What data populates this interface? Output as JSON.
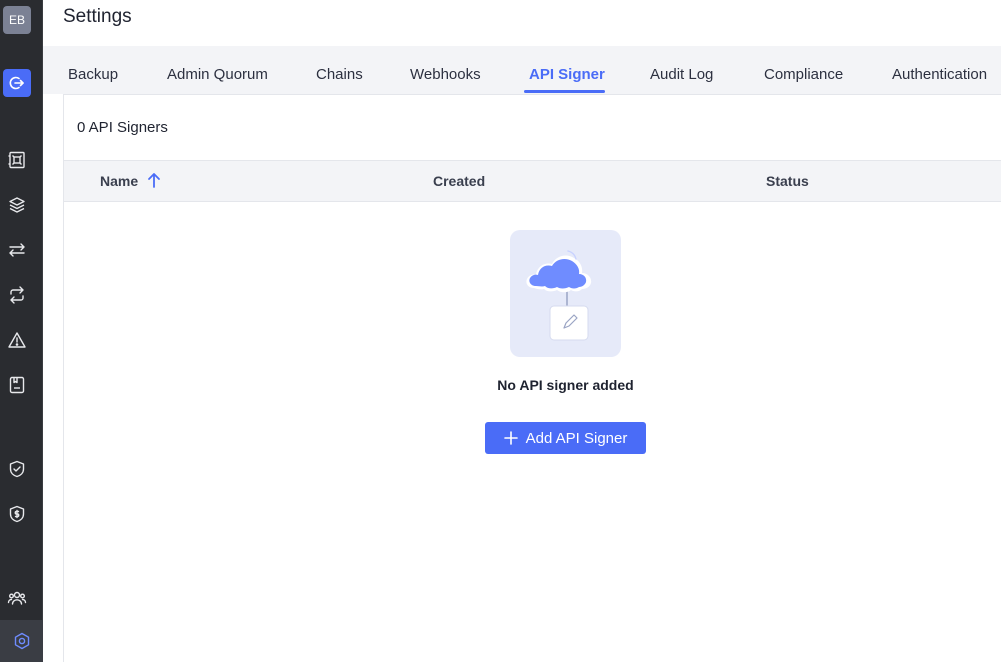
{
  "user": {
    "initials": "EB"
  },
  "sidebar": {
    "items": [
      {
        "icon": "logout-icon"
      },
      {
        "icon": "vault-icon"
      },
      {
        "icon": "layers-icon"
      },
      {
        "icon": "transfer-icon"
      },
      {
        "icon": "repeat-icon"
      },
      {
        "icon": "warning-icon"
      },
      {
        "icon": "clipboard-icon"
      },
      {
        "icon": "shield-check-icon"
      },
      {
        "icon": "shield-dollar-icon"
      },
      {
        "icon": "users-icon"
      },
      {
        "icon": "gear-icon"
      }
    ]
  },
  "header": {
    "title": "Settings"
  },
  "tabs": [
    {
      "label": "Backup"
    },
    {
      "label": "Admin Quorum"
    },
    {
      "label": "Chains"
    },
    {
      "label": "Webhooks"
    },
    {
      "label": "API Signer",
      "active": true
    },
    {
      "label": "Audit Log"
    },
    {
      "label": "Compliance"
    },
    {
      "label": "Authentication"
    }
  ],
  "content": {
    "count_label": "0 API Signers",
    "columns": [
      {
        "label": "Name",
        "sort": "ascending"
      },
      {
        "label": "Created"
      },
      {
        "label": "Status"
      }
    ],
    "empty_message": "No API signer added",
    "add_button_label": "Add API Signer"
  },
  "colors": {
    "accent": "#4a6cf7",
    "sidebar_bg": "#2a2c30",
    "illustration_bg": "#e6eaf9"
  }
}
